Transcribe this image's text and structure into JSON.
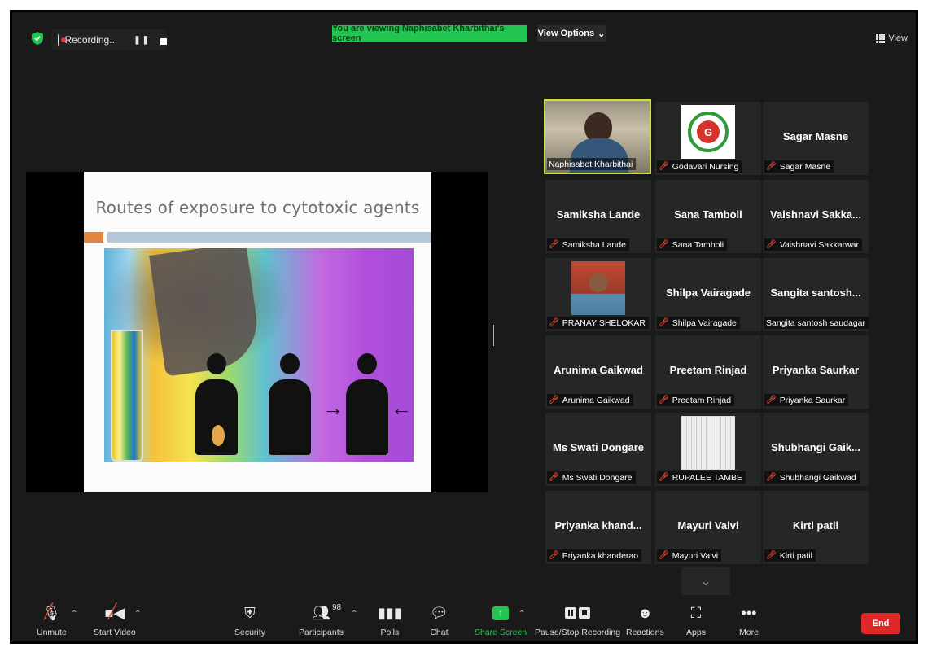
{
  "topbar": {
    "recording_label": "Recording...",
    "viewing_banner": "You are viewing Naphisabet Kharbithai's screen",
    "view_options": "View Options",
    "view_label": "View"
  },
  "slide": {
    "title": "Routes of exposure to cytotoxic agents",
    "colors": {
      "accent_orange": "#e2863f",
      "accent_blue": "#b3c7d9"
    }
  },
  "participants": [
    {
      "display": "",
      "label": "Naphisabet Kharbithai",
      "muted": false,
      "kind": "video",
      "active": true
    },
    {
      "display": "",
      "label": "Godavari Nursing",
      "muted": true,
      "kind": "logo"
    },
    {
      "display": "Sagar Masne",
      "label": "Sagar Masne",
      "muted": true
    },
    {
      "display": "Samiksha Lande",
      "label": "Samiksha Lande",
      "muted": true
    },
    {
      "display": "Sana Tamboli",
      "label": "Sana Tamboli",
      "muted": true
    },
    {
      "display": "Vaishnavi  Sakka...",
      "label": "Vaishnavi Sakkarwar",
      "muted": true
    },
    {
      "display": "",
      "label": "PRANAY SHELOKAR",
      "muted": true,
      "kind": "photo"
    },
    {
      "display": "Shilpa Vairagade",
      "label": "Shilpa Vairagade",
      "muted": true
    },
    {
      "display": "Sangita  santosh...",
      "label": "Sangita santosh saudagar",
      "muted": false
    },
    {
      "display": "Arunima Gaikwad",
      "label": "Arunima Gaikwad",
      "muted": true
    },
    {
      "display": "Preetam Rinjad",
      "label": "Preetam Rinjad",
      "muted": true
    },
    {
      "display": "Priyanka Saurkar",
      "label": "Priyanka Saurkar",
      "muted": true
    },
    {
      "display": "Ms Swati Dongare",
      "label": "Ms Swati Dongare",
      "muted": true
    },
    {
      "display": "",
      "label": "RUPALEE TAMBE",
      "muted": true,
      "kind": "photo"
    },
    {
      "display": "Shubhangi  Gaik...",
      "label": "Shubhangi Gaikwad",
      "muted": true
    },
    {
      "display": "Priyanka  khand...",
      "label": "Priyanka khanderao",
      "muted": true
    },
    {
      "display": "Mayuri Valvi",
      "label": "Mayuri Valvi",
      "muted": true
    },
    {
      "display": "Kirti patil",
      "label": "Kirti patil",
      "muted": true
    }
  ],
  "toolbar": {
    "unmute": "Unmute",
    "start_video": "Start Video",
    "security": "Security",
    "participants": "Participants",
    "participants_count": "98",
    "polls": "Polls",
    "chat": "Chat",
    "share_screen": "Share Screen",
    "pause_stop_recording": "Pause/Stop Recording",
    "reactions": "Reactions",
    "apps": "Apps",
    "more": "More",
    "end": "End"
  },
  "colors": {
    "background": "#1a1a1a",
    "banner_green": "#23c552",
    "end_red": "#e02828",
    "muted_red": "#e0483a",
    "active_speaker": "#c7e23c"
  }
}
